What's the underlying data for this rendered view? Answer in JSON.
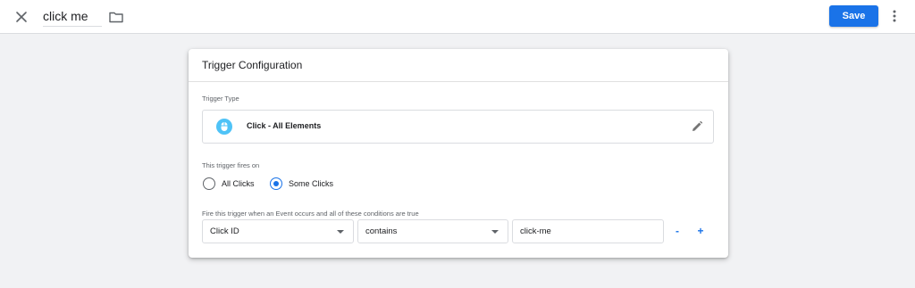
{
  "topbar": {
    "close_icon": "close-icon",
    "tag_name": "click me",
    "folder_icon": "folder-icon",
    "save_label": "Save",
    "more_icon": "more-vert-icon"
  },
  "card": {
    "title": "Trigger Configuration",
    "trigger_type_label": "Trigger Type",
    "trigger_type": {
      "name": "Click - All Elements",
      "icon": "cursor-click-icon",
      "edit_icon": "pencil-icon"
    },
    "fires_on_label": "This trigger fires on",
    "fires_on_options": [
      {
        "label": "All Clicks",
        "checked": false
      },
      {
        "label": "Some Clicks",
        "checked": true
      }
    ],
    "condition_label": "Fire this trigger when an Event occurs and all of these conditions are true",
    "condition": {
      "variable": "Click ID",
      "operator": "contains",
      "value": "click-me",
      "remove_label": "-",
      "add_label": "+"
    }
  },
  "colors": {
    "accent": "#1a73e8",
    "background": "#f1f2f4",
    "card": "#ffffff",
    "icon_bg": "#4fc3f7"
  }
}
